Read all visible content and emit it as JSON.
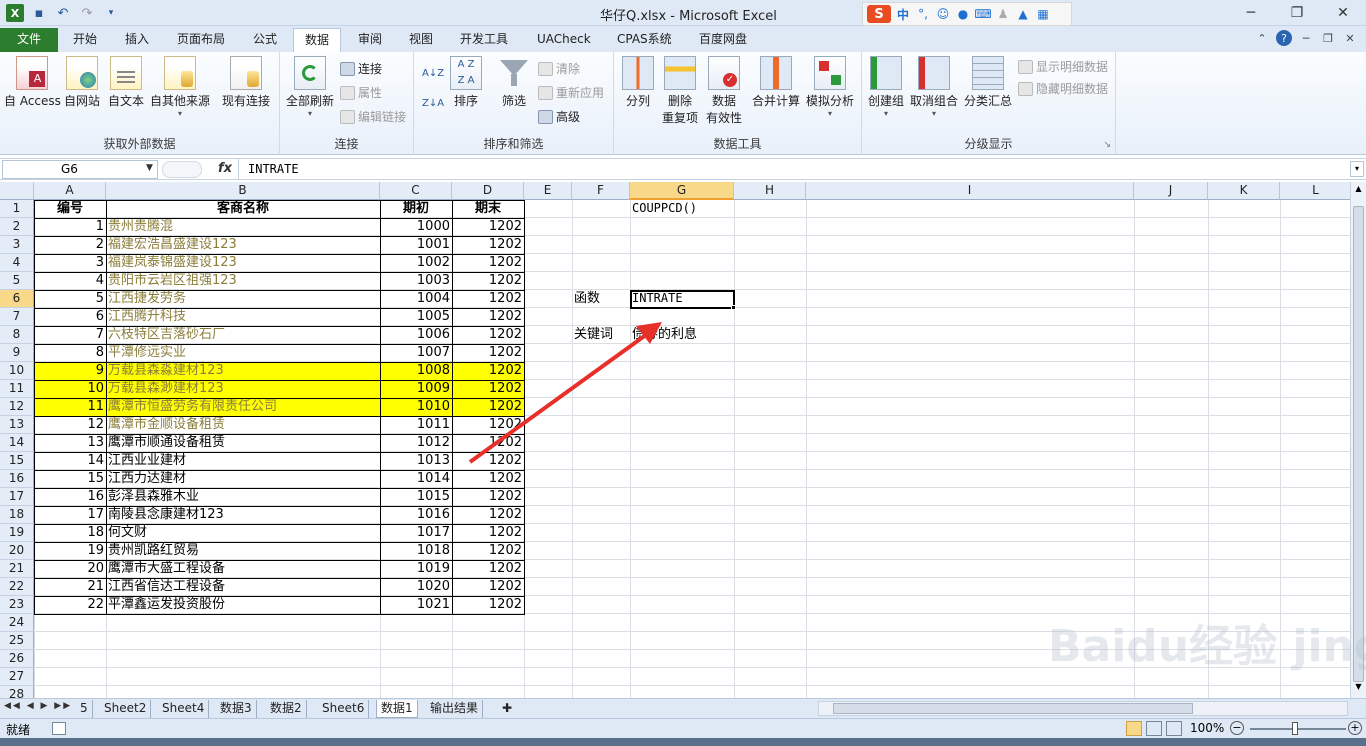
{
  "window": {
    "title": "华仔Q.xlsx - Microsoft Excel"
  },
  "ime": {
    "logo": "S",
    "lang": "中"
  },
  "tabs": [
    "文件",
    "开始",
    "插入",
    "页面布局",
    "公式",
    "数据",
    "审阅",
    "视图",
    "开发工具",
    "UACheck",
    "CPAS系统",
    "百度网盘"
  ],
  "active_tab": "数据",
  "ribbon": {
    "groups": {
      "external": "获取外部数据",
      "connections": "连接",
      "sort_filter": "排序和筛选",
      "data_tools": "数据工具",
      "outline": "分级显示"
    },
    "buttons": {
      "access": "自 Access",
      "web": "自网站",
      "text": "自文本",
      "other": "自其他来源",
      "existing": "现有连接",
      "refresh_all": "全部刷新",
      "connections": "连接",
      "properties": "属性",
      "edit_links": "编辑链接",
      "sort": "排序",
      "filter": "筛选",
      "clear": "清除",
      "reapply": "重新应用",
      "advanced": "高级",
      "split": "分列",
      "remove_dup_1": "删除",
      "remove_dup_2": "重复项",
      "validation_1": "数据",
      "validation_2": "有效性",
      "consolidate": "合并计算",
      "whatif": "模拟分析",
      "group": "创建组",
      "ungroup": "取消组合",
      "subtotal": "分类汇总",
      "show_detail": "显示明细数据",
      "hide_detail": "隐藏明细数据"
    }
  },
  "formula_bar": {
    "name_box": "G6",
    "fx": "fx",
    "formula": "INTRATE"
  },
  "columns": [
    "A",
    "B",
    "C",
    "D",
    "E",
    "F",
    "G",
    "H",
    "I",
    "J",
    "K",
    "L"
  ],
  "selected_col": "G",
  "header_row": {
    "a": "编号",
    "b": "客商名称",
    "c": "期初",
    "d": "期末"
  },
  "rows": [
    {
      "a": "1",
      "b": "贵州贵腾混",
      "c": "1000",
      "d": "1202"
    },
    {
      "a": "2",
      "b": "福建宏浩昌盛建设123",
      "c": "1001",
      "d": "1202"
    },
    {
      "a": "3",
      "b": "福建岚泰锦盛建设123",
      "c": "1002",
      "d": "1202"
    },
    {
      "a": "4",
      "b": "贵阳市云岩区祖强123",
      "c": "1003",
      "d": "1202"
    },
    {
      "a": "5",
      "b": "江西捷发劳务",
      "c": "1004",
      "d": "1202"
    },
    {
      "a": "6",
      "b": "江西腾升科技",
      "c": "1005",
      "d": "1202"
    },
    {
      "a": "7",
      "b": "六枝特区吉落砂石厂",
      "c": "1006",
      "d": "1202"
    },
    {
      "a": "8",
      "b": "平潭修远实业",
      "c": "1007",
      "d": "1202"
    },
    {
      "a": "9",
      "b": "万载县森淼建材123",
      "c": "1008",
      "d": "1202"
    },
    {
      "a": "10",
      "b": "万载县森渺建材123",
      "c": "1009",
      "d": "1202"
    },
    {
      "a": "11",
      "b": "鹰潭市恒盛劳务有限责任公司",
      "c": "1010",
      "d": "1202"
    },
    {
      "a": "12",
      "b": "鹰潭市金顺设备租赁",
      "c": "1011",
      "d": "1202"
    },
    {
      "a": "13",
      "b": "鹰潭市顺通设备租赁",
      "c": "1012",
      "d": "1202"
    },
    {
      "a": "14",
      "b": "江西业业建材",
      "c": "1013",
      "d": "1202"
    },
    {
      "a": "15",
      "b": "江西力达建材",
      "c": "1014",
      "d": "1202"
    },
    {
      "a": "16",
      "b": "彭泽县森雅木业",
      "c": "1015",
      "d": "1202"
    },
    {
      "a": "17",
      "b": "南陵县念康建材123",
      "c": "1016",
      "d": "1202"
    },
    {
      "a": "18",
      "b": "何文财",
      "c": "1017",
      "d": "1202"
    },
    {
      "a": "19",
      "b": "贵州凯路红贸易",
      "c": "1018",
      "d": "1202"
    },
    {
      "a": "20",
      "b": "鹰潭市大盛工程设备",
      "c": "1019",
      "d": "1202"
    },
    {
      "a": "21",
      "b": "江西省信达工程设备",
      "c": "1020",
      "d": "1202"
    },
    {
      "a": "22",
      "b": "平潭鑫运发投资股份",
      "c": "1021",
      "d": "1202"
    }
  ],
  "side": {
    "g1": "COUPPCD()",
    "f6": "函数",
    "g6": "INTRATE",
    "f8": "关键词",
    "g8": "债券的利息"
  },
  "colors": {
    "olive_text": "#8b7d3a",
    "highlight": "#ffff00",
    "arrow": "#e8302a",
    "file_tab": "#2d7d2f"
  },
  "sheet_tabs": [
    "5",
    "Sheet2",
    "Sheet4",
    "数据3",
    "数据2",
    "Sheet6",
    "数据1",
    "输出结果"
  ],
  "active_sheet": "数据1",
  "status": {
    "ready": "就绪",
    "zoom": "100%"
  },
  "watermark": "Baidu经验 jingyan.baidu.com"
}
